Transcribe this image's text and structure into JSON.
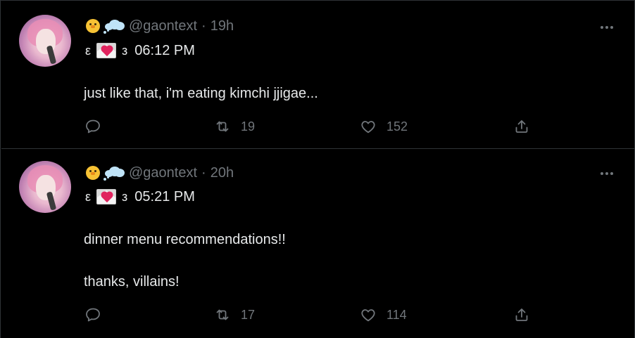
{
  "colors": {
    "background": "#000000",
    "text_primary": "#e7e9ea",
    "text_secondary": "#71767b",
    "divider": "#2f3336"
  },
  "tweets": [
    {
      "handle": "@gaontext",
      "separator": "·",
      "time_ago": "19h",
      "paren_open": "ε",
      "paren_close": "з",
      "header_time": "06:12 PM",
      "lines": [
        "just like that, i'm eating kimchi jjigae..."
      ],
      "retweets": "19",
      "likes": "152"
    },
    {
      "handle": "@gaontext",
      "separator": "·",
      "time_ago": "20h",
      "paren_open": "ε",
      "paren_close": "з",
      "header_time": "05:21 PM",
      "lines": [
        "dinner menu recommendations!!",
        "thanks, villains!"
      ],
      "retweets": "17",
      "likes": "114"
    }
  ],
  "icons": {
    "name_emoji_1": "baby-chick-emoji",
    "name_emoji_2": "thought-balloon-emoji",
    "mail_emoji": "love-letter-emoji",
    "more": "more-horizontal-icon",
    "reply": "reply-icon",
    "retweet": "retweet-icon",
    "like": "heart-icon",
    "share": "share-icon"
  }
}
